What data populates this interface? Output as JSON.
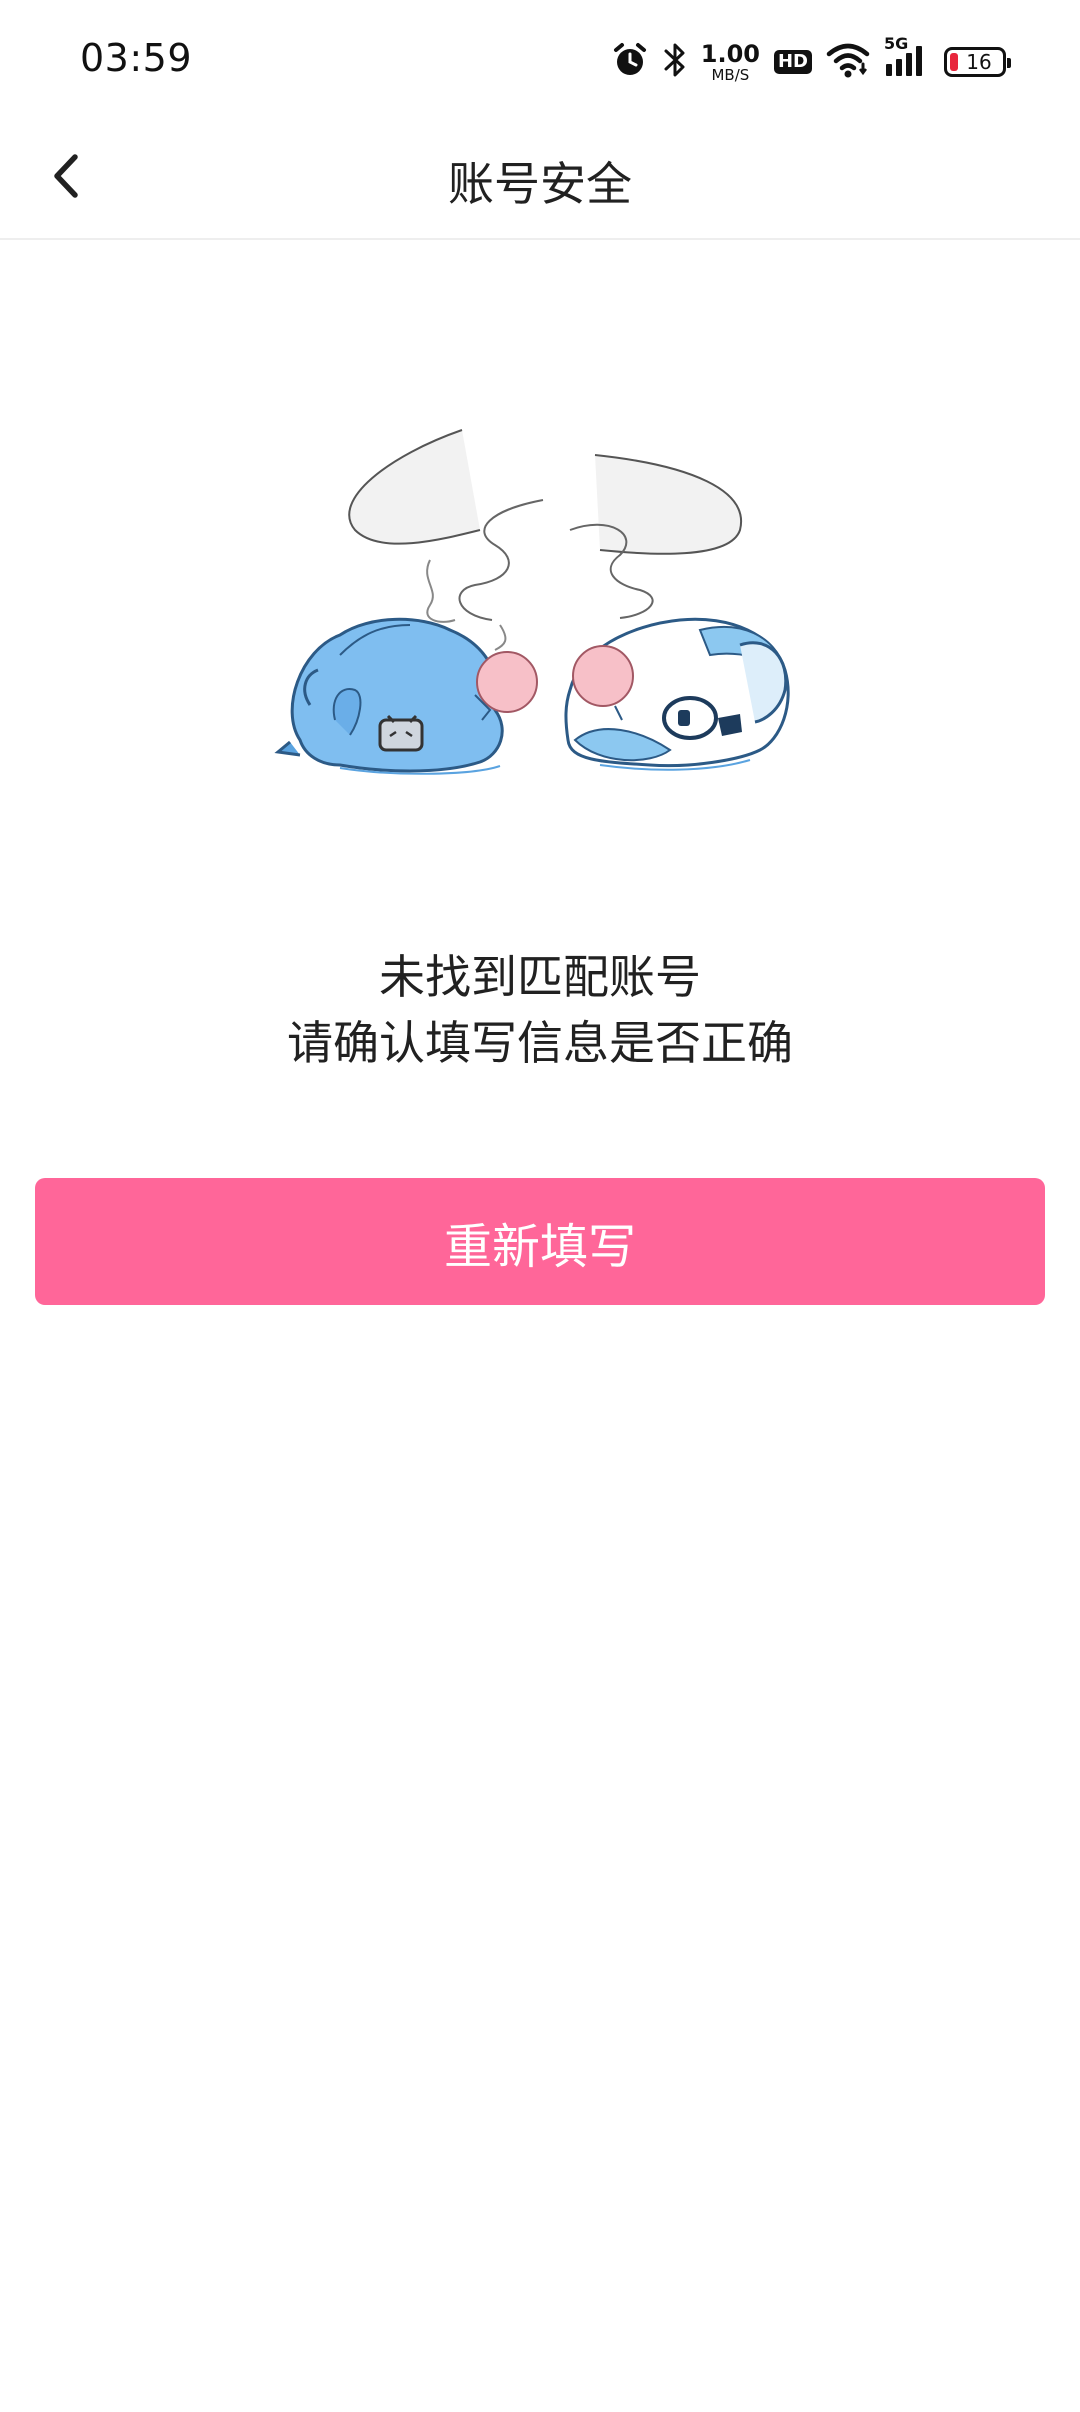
{
  "status_bar": {
    "time": "03:59",
    "network_speed_value": "1.00",
    "network_speed_unit": "MB/S",
    "hd_label": "HD",
    "network_type": "5G",
    "battery_level": "16",
    "icons": [
      "alarm-icon",
      "bluetooth-icon",
      "hd-icon",
      "wifi-icon",
      "signal-icon",
      "battery-icon"
    ]
  },
  "nav": {
    "title": "账号安全",
    "back_icon": "chevron-left-icon"
  },
  "main": {
    "illustration": "sleeping-mascots-illustration",
    "message_line1": "未找到匹配账号",
    "message_line2": "请确认填写信息是否正确",
    "retry_label": "重新填写"
  },
  "colors": {
    "accent": "#ff6699",
    "text": "#212121",
    "divider": "#eeeeee",
    "battery_low": "#e8263c",
    "mascot_blue": "#7fbef0",
    "mascot_pink": "#f7c0c8"
  }
}
